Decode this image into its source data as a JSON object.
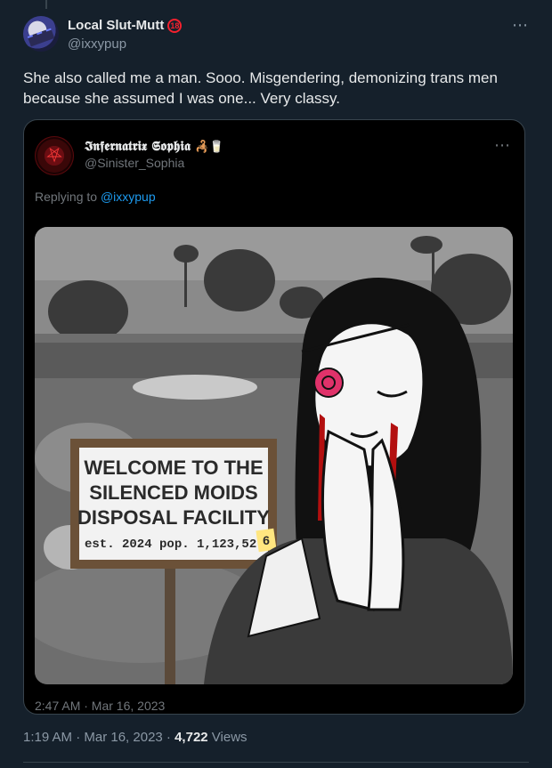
{
  "tweet": {
    "display_name": "Local Slut-Mutt",
    "badge": "18",
    "handle": "@ixxypup",
    "more_icon": "⋯",
    "text": "She also called me a man. Sooo. Misgendering, demonizing trans men because she assumed I was one... Very classy.",
    "time": "1:19 AM · Mar 16, 2023 · ",
    "views_count": "4,722",
    "views_label": " Views"
  },
  "quoted": {
    "display_name": "𝕴𝖓𝖋𝖊𝖗𝖓𝖆𝖙𝖗𝖎𝖝 𝕾𝖔𝖕𝖍𝖎𝖆",
    "name_emoji": "🦂🥛",
    "handle": "@Sinister_Sophia",
    "more_icon": "⋯",
    "replying_prefix": "Replying to ",
    "replying_mention": "@ixxypup",
    "time": "2:47 AM · Mar 16, 2023",
    "image": {
      "sign_line1": "WELCOME TO THE",
      "sign_line2": "SILENCED MOIDS",
      "sign_line3": "DISPOSAL FACILITY",
      "sign_line4": "est. 2024 pop. 1,123,52",
      "sign_note": "6"
    }
  },
  "colors": {
    "background": "#15202b",
    "accent": "#1d9bf0",
    "badge": "#f4212e"
  }
}
